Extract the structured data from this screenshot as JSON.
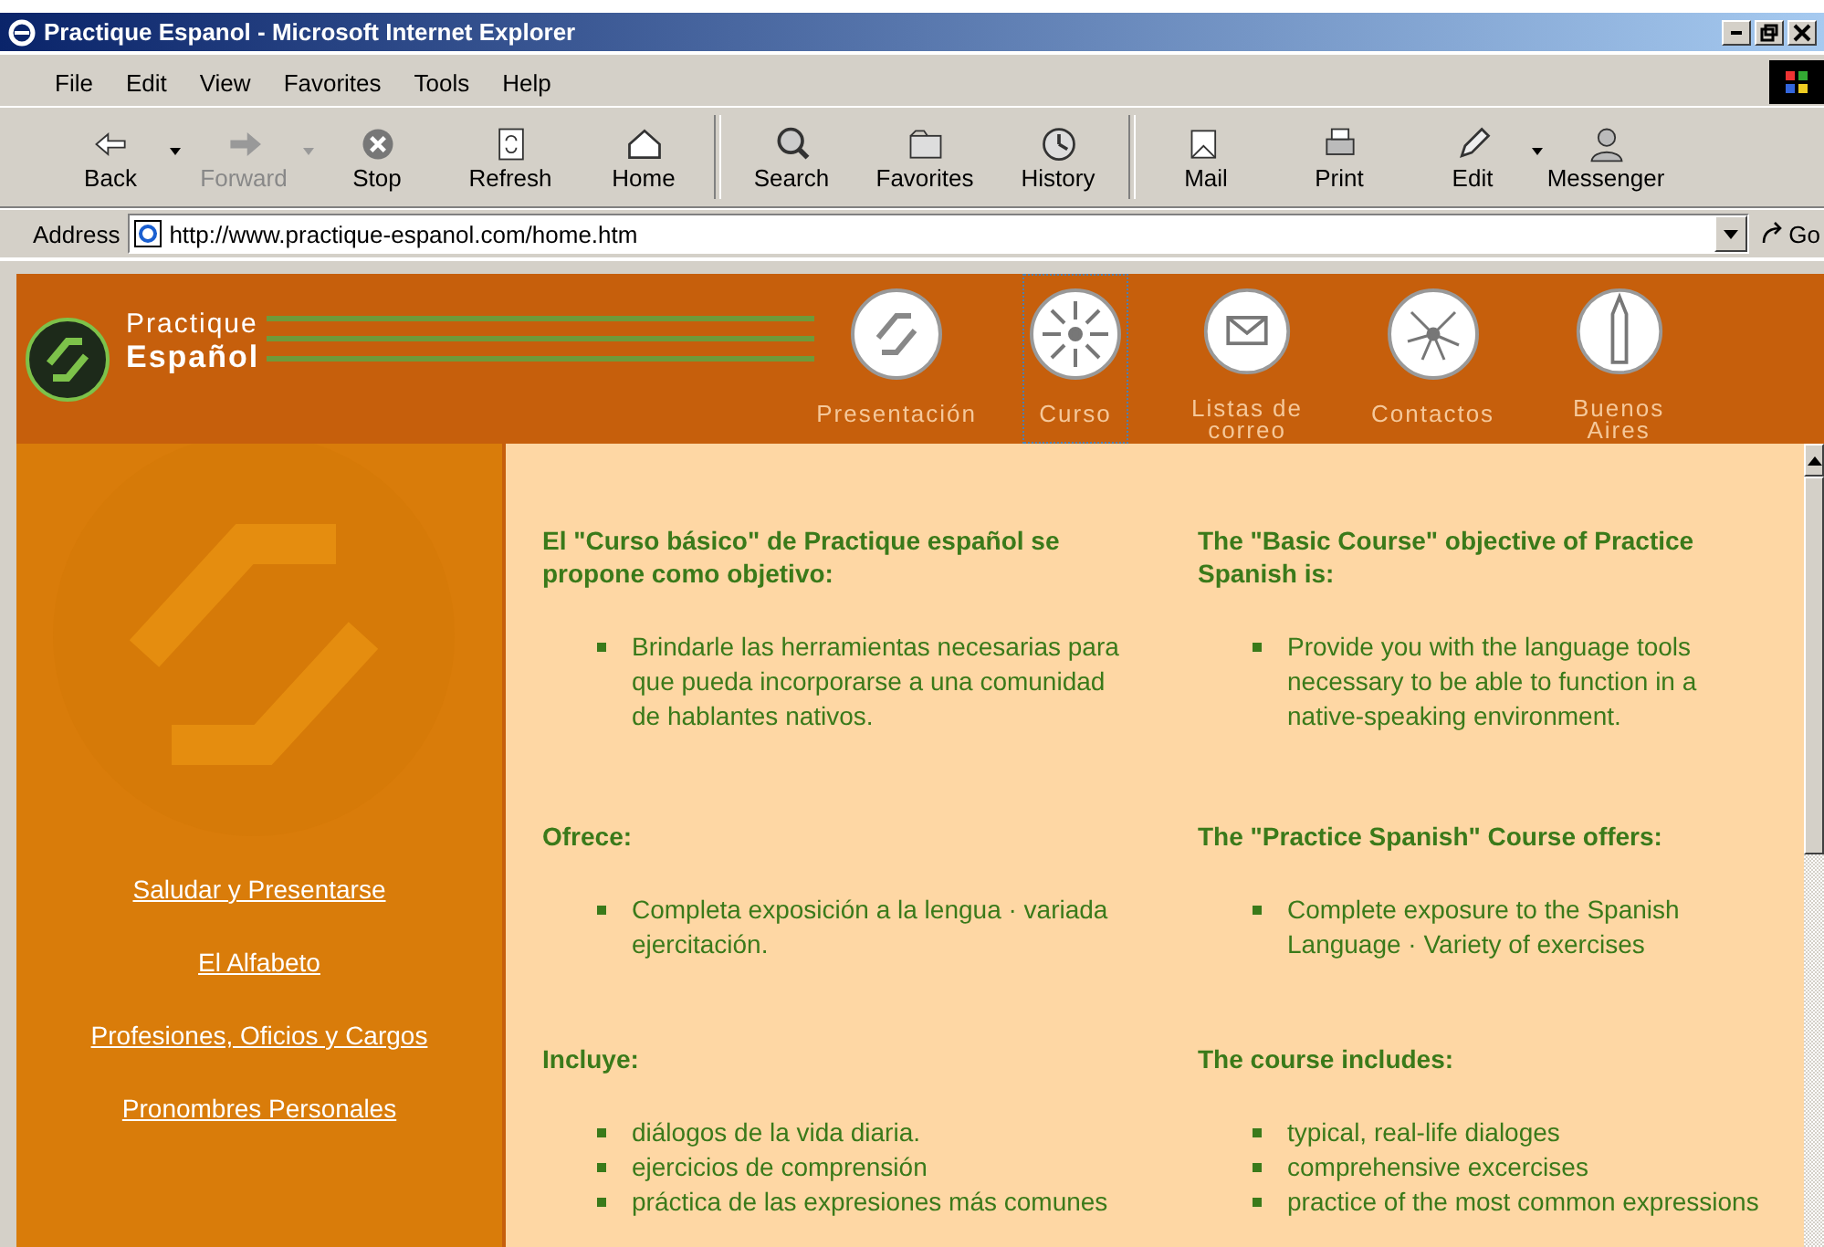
{
  "window": {
    "title": "Practique Espanol - Microsoft Internet Explorer"
  },
  "menu": [
    "File",
    "Edit",
    "View",
    "Favorites",
    "Tools",
    "Help"
  ],
  "toolbar": [
    {
      "label": "Back",
      "disabled": false,
      "dropdown": true
    },
    {
      "label": "Forward",
      "disabled": true,
      "dropdown": true
    },
    {
      "label": "Stop",
      "disabled": false,
      "dropdown": false
    },
    {
      "label": "Refresh",
      "disabled": false,
      "dropdown": false
    },
    {
      "label": "Home",
      "disabled": false,
      "dropdown": false
    },
    {
      "label": "Search",
      "disabled": false,
      "dropdown": false
    },
    {
      "label": "Favorites",
      "disabled": false,
      "dropdown": false
    },
    {
      "label": "History",
      "disabled": false,
      "dropdown": false
    },
    {
      "label": "Mail",
      "disabled": false,
      "dropdown": false
    },
    {
      "label": "Print",
      "disabled": false,
      "dropdown": false
    },
    {
      "label": "Edit",
      "disabled": false,
      "dropdown": true
    },
    {
      "label": "Messenger",
      "disabled": false,
      "dropdown": false
    }
  ],
  "address": {
    "label": "Address",
    "value": "http://www.practique-espanol.com/home.htm",
    "go": "Go"
  },
  "site": {
    "logo_top": "Practique",
    "logo_bottom": "Español",
    "nav": [
      {
        "label": "Presentación",
        "selected": false
      },
      {
        "label": "Curso",
        "selected": true
      },
      {
        "label": "Listas de correo",
        "selected": false
      },
      {
        "label": "Contactos",
        "selected": false
      },
      {
        "label": "Buenos Aires",
        "selected": false
      }
    ],
    "sidebar_links": [
      "Saludar y Presentarse",
      "El Alfabeto",
      "Profesiones, Oficios y Cargos",
      "Pronombres Personales"
    ],
    "columns": [
      [
        {
          "heading": "El \"Curso básico\" de Practique español se propone como objetivo:",
          "items": [
            "Brindarle las herramientas necesarias para que pueda incorporarse a una comunidad de hablantes nativos."
          ]
        },
        {
          "heading": "Ofrece:",
          "items": [
            "Completa exposición a la lengua · variada ejercitación."
          ]
        },
        {
          "heading": "Incluye:",
          "items": [
            "diálogos de la vida diaria.",
            "ejercicios de comprensión",
            "práctica de las expresiones más comunes"
          ]
        }
      ],
      [
        {
          "heading": "The \"Basic Course\" objective of Practice Spanish is:",
          "items": [
            "Provide you with the language tools necessary to be able to function in a native-speaking environment."
          ]
        },
        {
          "heading": "The \"Practice Spanish\" Course offers:",
          "items": [
            "Complete exposure to the Spanish Language · Variety of exercises"
          ]
        },
        {
          "heading": "The course includes:",
          "items": [
            "typical, real-life dialoges",
            "comprehensive excercises",
            "practice of the most common expressions"
          ]
        }
      ]
    ]
  }
}
